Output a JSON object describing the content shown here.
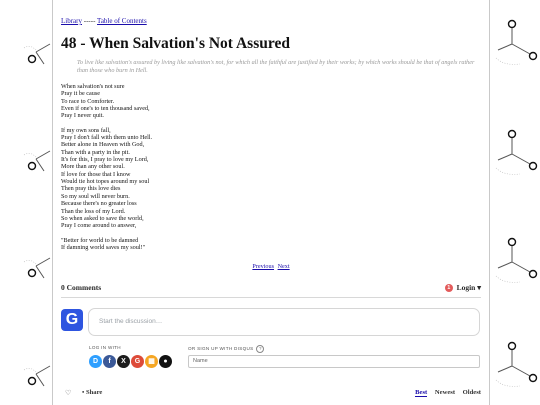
{
  "breadcrumb": {
    "library": "Library",
    "separator": "-----",
    "toc": "Table of Contents"
  },
  "title": "48 - When Salvation's Not Assured",
  "epigraph": "To live like salvation's assured by living like salvation's not, for which all the faithful are justified by their works; by which works should be that of angels rather than those who burn in Hell.",
  "poem": {
    "stanza1": [
      "When salvation's not sure",
      "Pray it be cause",
      "To race to Comforter.",
      "Even if one's to ten thousand saved,",
      "Pray I never quit."
    ],
    "stanza2": [
      "If my own sons fall,",
      "Pray I don't fall with them unto Hell.",
      "Better alone in Heaven with God,",
      "Than with a party in the pit.",
      "It's for this, I pray to love my Lord,",
      "More than any other soul.",
      "If love for those that I know",
      "Would tie hot topes around my soul",
      "Then pray this love dies",
      "So my soul will never burn.",
      "Because there's no greater loss",
      "Than the loss of my Lord.",
      "So when asked to save the world,",
      "Pray I come around to answer,"
    ],
    "stanza3": [
      "\"Better for world to be damned",
      "If damning world saves my soul!\""
    ]
  },
  "pager": {
    "previous": "Previous",
    "next": "Next"
  },
  "comments": {
    "count": "0 Comments",
    "badge": "1",
    "login": "Login ▾",
    "avatar_letter": "G",
    "placeholder": "Start the discussion…",
    "login_with": "LOG IN WITH",
    "signup_with": "OR SIGN UP WITH DISQUS",
    "help": "?",
    "name_placeholder": "Name",
    "share": "• Share",
    "heart": "♡",
    "sort": {
      "best": "Best",
      "newest": "Newest",
      "oldest": "Oldest"
    }
  },
  "social": [
    {
      "name": "disqus",
      "glyph": "D",
      "color": "#2e9fff"
    },
    {
      "name": "facebook",
      "glyph": "f",
      "color": "#3b5998"
    },
    {
      "name": "x",
      "glyph": "X",
      "color": "#1c1c1c"
    },
    {
      "name": "google",
      "glyph": "G",
      "color": "#dd4b39"
    },
    {
      "name": "microsoft",
      "glyph": "▦",
      "color": "#f5a623"
    },
    {
      "name": "apple",
      "glyph": "●",
      "color": "#111111"
    }
  ]
}
